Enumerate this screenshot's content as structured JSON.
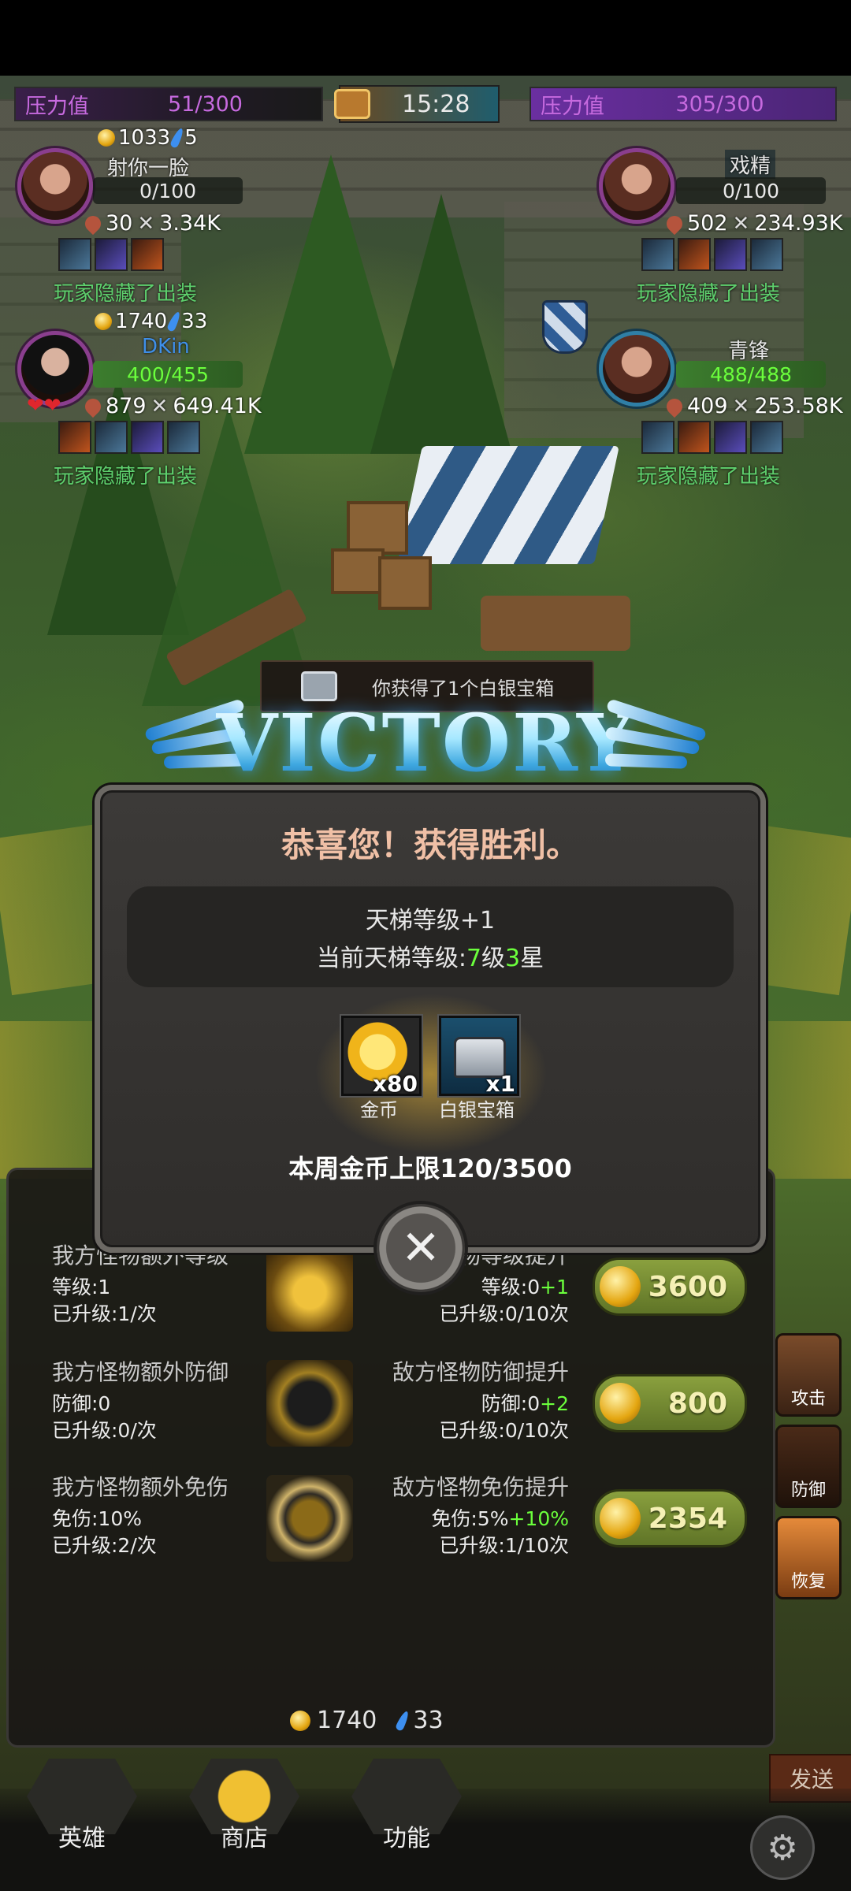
{
  "hud": {
    "left_pressure": {
      "label": "压力值",
      "value": "51/300"
    },
    "right_pressure": {
      "label": "压力值",
      "value": "305/300"
    },
    "timer": "15:28"
  },
  "players": [
    {
      "name": "射你一脸",
      "gold": "1033",
      "gems": "5",
      "hp": "0/100",
      "power": "30",
      "attack": "3.34K",
      "hidden_gear": "玩家隐藏了出装"
    },
    {
      "name": "戏精",
      "hp": "0/100",
      "power": "502",
      "attack": "234.93K",
      "hidden_gear": "玩家隐藏了出装"
    },
    {
      "name": "DKin",
      "gold": "1740",
      "gems": "33",
      "hp": "400/455",
      "power": "879",
      "attack": "649.41K",
      "hidden_gear": "玩家隐藏了出装"
    },
    {
      "name": "青锋",
      "hp": "488/488",
      "power": "409",
      "attack": "253.58K",
      "hidden_gear": "玩家隐藏了出装"
    }
  ],
  "toast": "你获得了1个白银宝箱",
  "victory_text": "VICTORY",
  "dialog": {
    "title": "恭喜您！获得胜利。",
    "ladder_up": "天梯等级+1",
    "ladder_current_prefix": "当前天梯等级:",
    "ladder_level": "7",
    "ladder_level_unit": "级",
    "ladder_stars": "3",
    "ladder_star_unit": "星",
    "rewards": [
      {
        "name": "金币",
        "count": "x80",
        "icon": "gold-coin-icon"
      },
      {
        "name": "白银宝箱",
        "count": "x1",
        "icon": "silver-chest-icon"
      }
    ],
    "weekly_cap": "本周金币上限120/3500"
  },
  "upgrades": [
    {
      "left_title": "我方怪物额外等级",
      "left_line1": "等级:1",
      "left_line2": "已升级:1/次",
      "right_title": "敌方怪物等级提升",
      "right_line1_base": "等级:0",
      "right_line1_delta": "+1",
      "right_line2": "已升级:0/10次",
      "cost": "3600"
    },
    {
      "left_title": "我方怪物额外防御",
      "left_line1": "防御:0",
      "left_line2": "已升级:0/次",
      "right_title": "敌方怪物防御提升",
      "right_line1_base": "防御:0",
      "right_line1_delta": "+2",
      "right_line2": "已升级:0/10次",
      "cost": "800"
    },
    {
      "left_title": "我方怪物额外免伤",
      "left_line1": "免伤:10%",
      "left_line2": "已升级:2/次",
      "right_title": "敌方怪物免伤提升",
      "right_line1_base": "免伤:5%",
      "right_line1_delta": "+10%",
      "right_line2": "已升级:1/10次",
      "cost": "2354"
    }
  ],
  "balance": {
    "gold": "1740",
    "gems": "33"
  },
  "side_buttons": [
    "攻击",
    "防御",
    "恢复"
  ],
  "send_label": "发送",
  "nav": [
    "英雄",
    "商店",
    "功能"
  ],
  "colors": {
    "pressure_text": "#c76adf",
    "hidden_gear_text": "#5ed06d",
    "highlight_green": "#6bff3c",
    "cost_button": "#7a9236"
  }
}
